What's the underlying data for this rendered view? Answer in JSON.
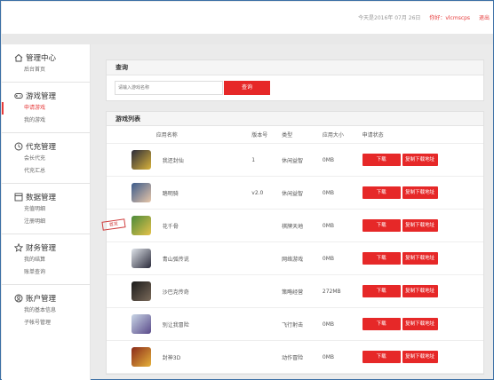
{
  "topbar": {
    "date_text": "今天是2016年 07月 26日",
    "greeting": "你好：vlcmscps",
    "logout": "退出"
  },
  "sidebar": {
    "groups": [
      {
        "title": "管理中心",
        "icon": "home-icon",
        "items": [
          "后台首页"
        ]
      },
      {
        "title": "游戏管理",
        "icon": "gamepad-icon",
        "items": [
          "申请游戏",
          "我的游戏"
        ]
      },
      {
        "title": "代充管理",
        "icon": "recharge-icon",
        "items": [
          "会长代充",
          "代充汇总"
        ]
      },
      {
        "title": "数据管理",
        "icon": "data-icon",
        "items": [
          "充值明细",
          "注册明细"
        ]
      },
      {
        "title": "财务管理",
        "icon": "star-icon",
        "items": [
          "我的结算",
          "账单查询"
        ]
      },
      {
        "title": "账户管理",
        "icon": "user-icon",
        "items": [
          "我的基本信息",
          "子帐号管理"
        ]
      }
    ],
    "active_item": "申请游戏"
  },
  "query": {
    "title": "查询",
    "placeholder": "请输入游戏名称",
    "button": "查询"
  },
  "list": {
    "title": "游戏列表",
    "columns": [
      "应用名称",
      "版本号",
      "类型",
      "应用大小",
      "申请状态"
    ],
    "rows": [
      {
        "name": "我还封仙",
        "version": "1",
        "type": "休闲益智",
        "size": "0MB",
        "download": "下载",
        "copy": "复制下载地址",
        "colors": [
          "#2b2b3a",
          "#d9b33a"
        ]
      },
      {
        "name": "踏明骑",
        "version": "v2.0",
        "type": "休闲益智",
        "size": "0MB",
        "download": "下载",
        "copy": "复制下载地址",
        "colors": [
          "#3a5a8a",
          "#e8c6a8"
        ]
      },
      {
        "name": "花千骨",
        "version": "",
        "type": "棋牌天地",
        "size": "0MB",
        "download": "下载",
        "copy": "复制下载地址",
        "colors": [
          "#4a8a3a",
          "#e6c24a"
        ],
        "badge": "首发"
      },
      {
        "name": "青山弧传说",
        "version": "",
        "type": "网络游戏",
        "size": "0MB",
        "download": "下载",
        "copy": "复制下载地址",
        "colors": [
          "#dfe4ea",
          "#2a2a3a"
        ]
      },
      {
        "name": "沙巴克传奇",
        "version": "",
        "type": "策略经营",
        "size": "272MB",
        "download": "下载",
        "copy": "复制下载地址",
        "colors": [
          "#1a1a1a",
          "#7a6a5a"
        ]
      },
      {
        "name": "别让我冒险",
        "version": "",
        "type": "飞行射击",
        "size": "0MB",
        "download": "下载",
        "copy": "复制下载地址",
        "colors": [
          "#c9d6e6",
          "#5a4a8a"
        ]
      },
      {
        "name": "封神3D",
        "version": "",
        "type": "动作冒险",
        "size": "0MB",
        "download": "下载",
        "copy": "复制下载地址",
        "colors": [
          "#8a2a1a",
          "#e6b23a"
        ]
      }
    ]
  }
}
